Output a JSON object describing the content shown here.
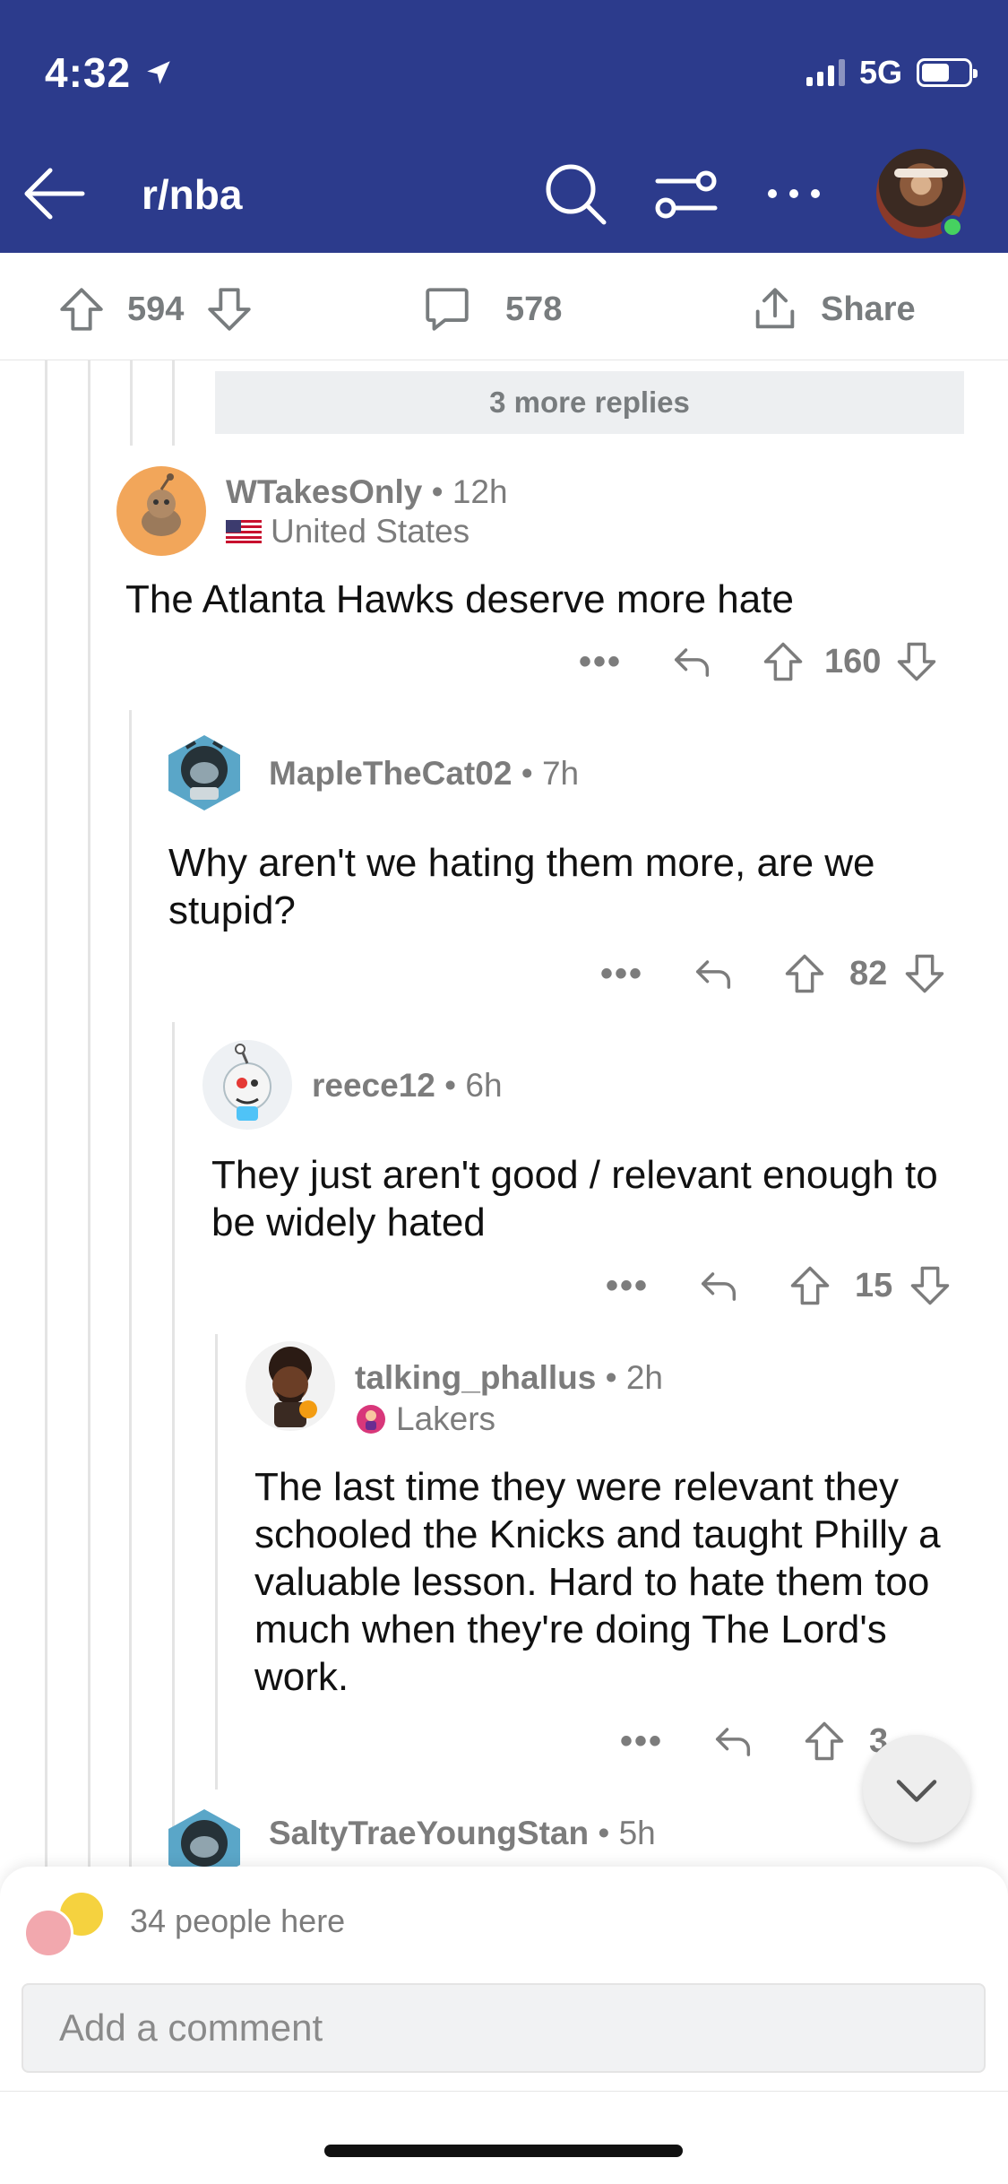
{
  "status_bar": {
    "time": "4:32",
    "network": "5G"
  },
  "header": {
    "subreddit": "r/nba"
  },
  "post_actions": {
    "upvotes": "594",
    "comments": "578",
    "share_label": "Share"
  },
  "more_replies": "3 more replies",
  "comments": [
    {
      "user": "WTakesOnly",
      "age": "12h",
      "flair": "United States",
      "body": "The Atlanta Hawks deserve more hate",
      "score": "160"
    },
    {
      "user": "MapleTheCat02",
      "age": "7h",
      "body": "Why aren't we hating them more, are we stupid?",
      "score": "82"
    },
    {
      "user": "reece12",
      "age": "6h",
      "body": "They just aren't good / relevant enough to be widely hated",
      "score": "15"
    },
    {
      "user": "talking_phallus",
      "age": "2h",
      "flair": "Lakers",
      "body": "The last time they were relevant they schooled the Knicks and taught Philly a valuable lesson. Hard to hate them too much when they're doing The Lord's work.",
      "score": "3"
    },
    {
      "user": "SaltyTraeYoungStan",
      "age": "5h"
    }
  ],
  "composer": {
    "presence": "34 people here",
    "placeholder": "Add a comment"
  },
  "colors": {
    "header_bg": "#2c3b8c",
    "online": "#46d160",
    "meta_gray": "#7c7c7c"
  }
}
